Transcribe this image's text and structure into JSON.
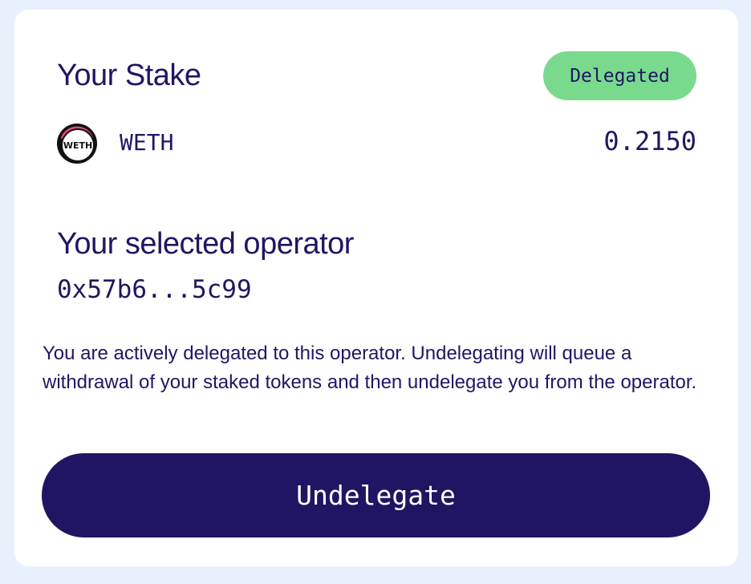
{
  "stake": {
    "title": "Your Stake",
    "status_badge": "Delegated",
    "token": {
      "icon_name": "weth-token-icon",
      "icon_text": "WETH",
      "name": "WETH",
      "amount": "0.2150"
    }
  },
  "operator": {
    "title": "Your selected operator",
    "address": "0x57b6...5c99"
  },
  "description": "You are actively delegated to this operator. Undelegating will queue a withdrawal of your staked tokens and then undelegate you from the operator.",
  "actions": {
    "undelegate_label": "Undelegate"
  },
  "colors": {
    "primary": "#1f1562",
    "badge_green": "#79da8e",
    "page_background": "#e9f0fd",
    "card_background": "#ffffff",
    "icon_accent": "#e8487a"
  }
}
